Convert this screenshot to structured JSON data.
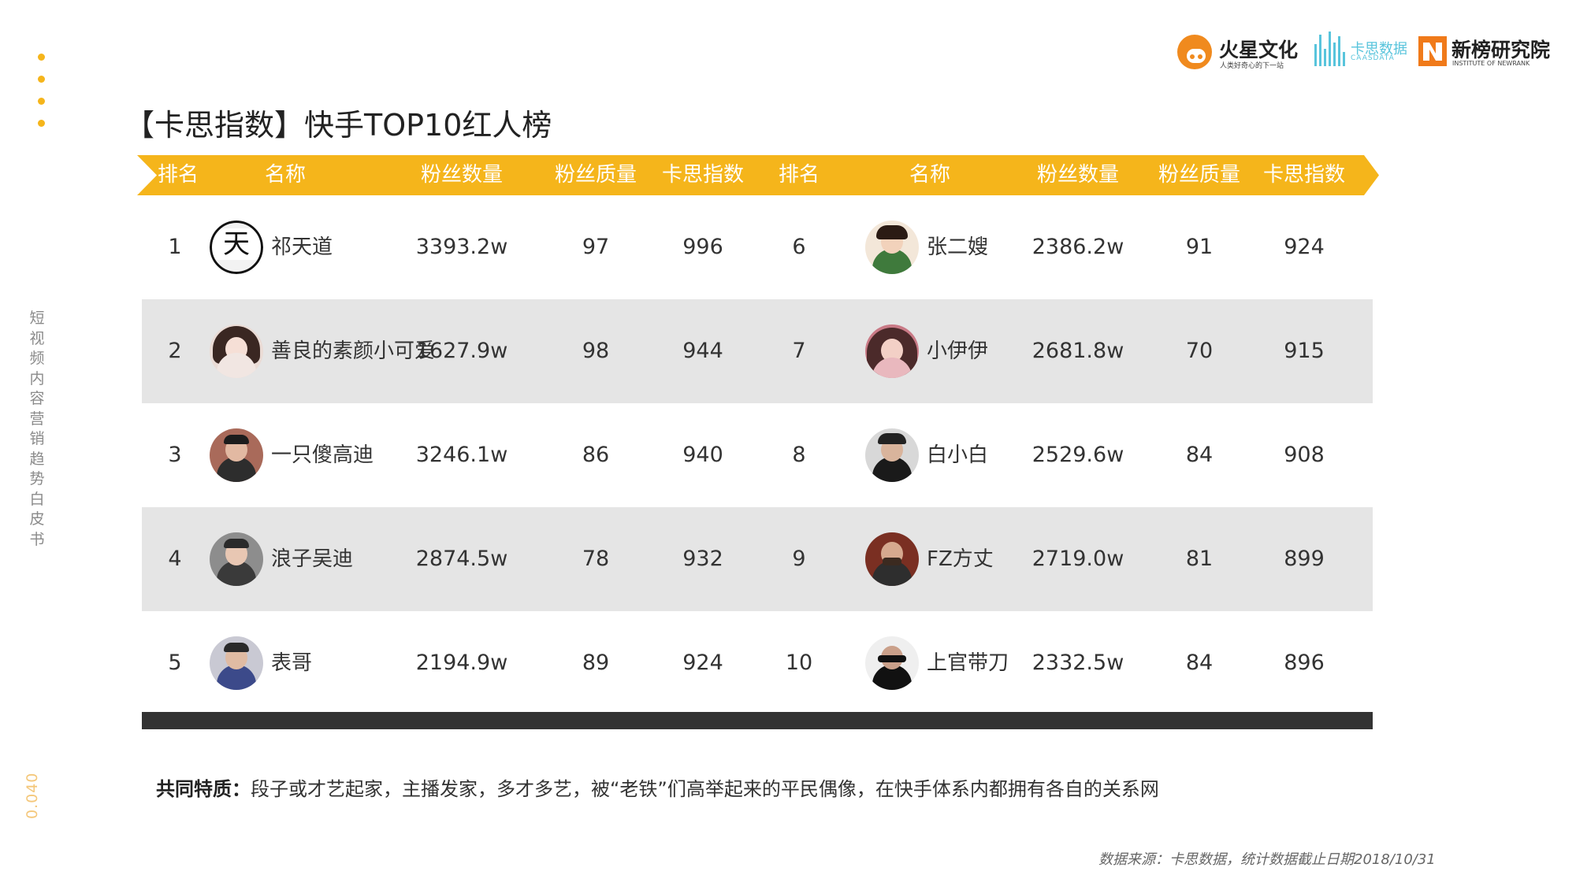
{
  "sidebar": {
    "title": "短视频内容营销趋势白皮书",
    "page_number": "0.040"
  },
  "logos": {
    "huoxing": {
      "name": "火星文化",
      "tagline": "人类好奇心的下一站"
    },
    "kasi": {
      "name": "卡思数据",
      "tagline": "CAASDATA"
    },
    "xinbang": {
      "name": "新榜研究院",
      "tagline": "INSTITUTE OF NEWRANK"
    }
  },
  "title": "【卡思指数】快手TOP10红人榜",
  "table": {
    "headers": [
      "排名",
      "名称",
      "粉丝数量",
      "粉丝质量",
      "卡思指数",
      "排名",
      "名称",
      "粉丝数量",
      "粉丝质量",
      "卡思指数"
    ],
    "rows": [
      {
        "left": {
          "rank": "1",
          "name": "祁天道",
          "fans": "3393.2w",
          "quality": "97",
          "index": "996"
        },
        "right": {
          "rank": "6",
          "name": "张二嫂",
          "fans": "2386.2w",
          "quality": "91",
          "index": "924"
        }
      },
      {
        "left": {
          "rank": "2",
          "name": "善良的素颜小可爱",
          "fans": "1627.9w",
          "quality": "98",
          "index": "944"
        },
        "right": {
          "rank": "7",
          "name": "小伊伊",
          "fans": "2681.8w",
          "quality": "70",
          "index": "915"
        }
      },
      {
        "left": {
          "rank": "3",
          "name": "一只傻高迪",
          "fans": "3246.1w",
          "quality": "86",
          "index": "940"
        },
        "right": {
          "rank": "8",
          "name": "白小白",
          "fans": "2529.6w",
          "quality": "84",
          "index": "908"
        }
      },
      {
        "left": {
          "rank": "4",
          "name": "浪子吴迪",
          "fans": "2874.5w",
          "quality": "78",
          "index": "932"
        },
        "right": {
          "rank": "9",
          "name": "FZ方丈",
          "fans": "2719.0w",
          "quality": "81",
          "index": "899"
        }
      },
      {
        "left": {
          "rank": "5",
          "name": "表哥",
          "fans": "2194.9w",
          "quality": "89",
          "index": "924"
        },
        "right": {
          "rank": "10",
          "name": "上官带刀",
          "fans": "2332.5w",
          "quality": "84",
          "index": "896"
        }
      }
    ]
  },
  "summary": {
    "label": "共同特质：",
    "text": "段子或才艺起家，主播发家，多才多艺，被“老铁”们高举起来的平民偶像，在快手体系内都拥有各自的关系网"
  },
  "source": "数据来源：卡思数据，统计数据截止日期2018/10/31",
  "colors": {
    "accent": "#f5b51b",
    "alt_row": "#e5e5e5",
    "footer_bar": "#333333"
  }
}
